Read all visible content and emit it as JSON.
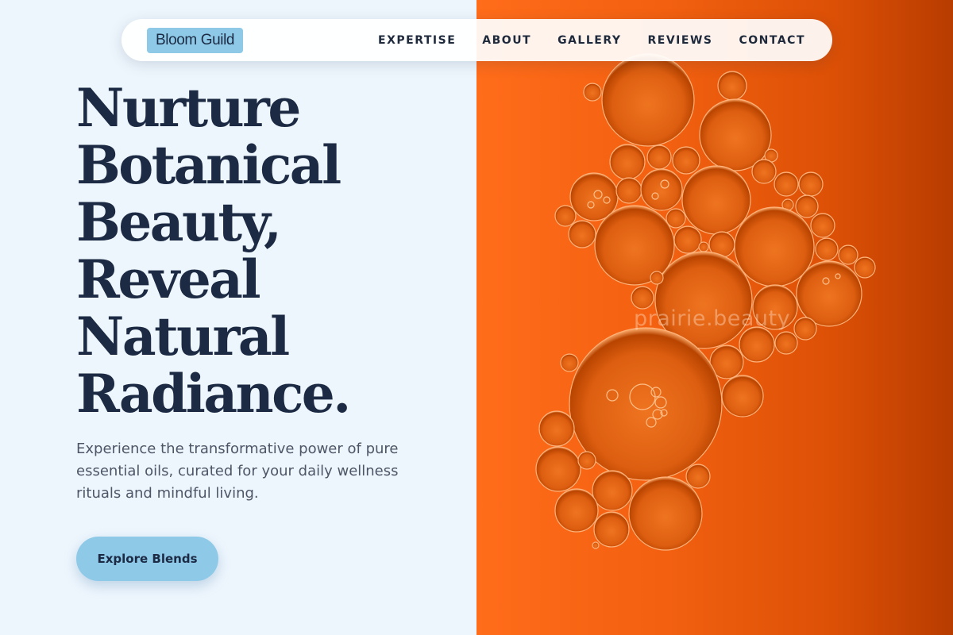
{
  "brand": {
    "logo_text": "Bloom Guild"
  },
  "nav": {
    "items": [
      {
        "label": "EXPERTISE"
      },
      {
        "label": "ABOUT"
      },
      {
        "label": "GALLERY"
      },
      {
        "label": "REVIEWS"
      },
      {
        "label": "CONTACT"
      }
    ]
  },
  "hero": {
    "headline_lines": [
      "Nurture",
      "Botanical",
      "Beauty,",
      "Reveal",
      "Natural",
      "Radiance."
    ],
    "subtitle": "Experience the transformative power of pure essential oils, curated for your daily wellness rituals and mindful living.",
    "cta_label": "Explore Blends"
  },
  "image": {
    "watermark": "prairie.beauty"
  },
  "colors": {
    "accent": "#8ec9e8",
    "text_dark": "#1c2a44",
    "background": "#eef6fd",
    "image_orange": "#e5580a"
  }
}
